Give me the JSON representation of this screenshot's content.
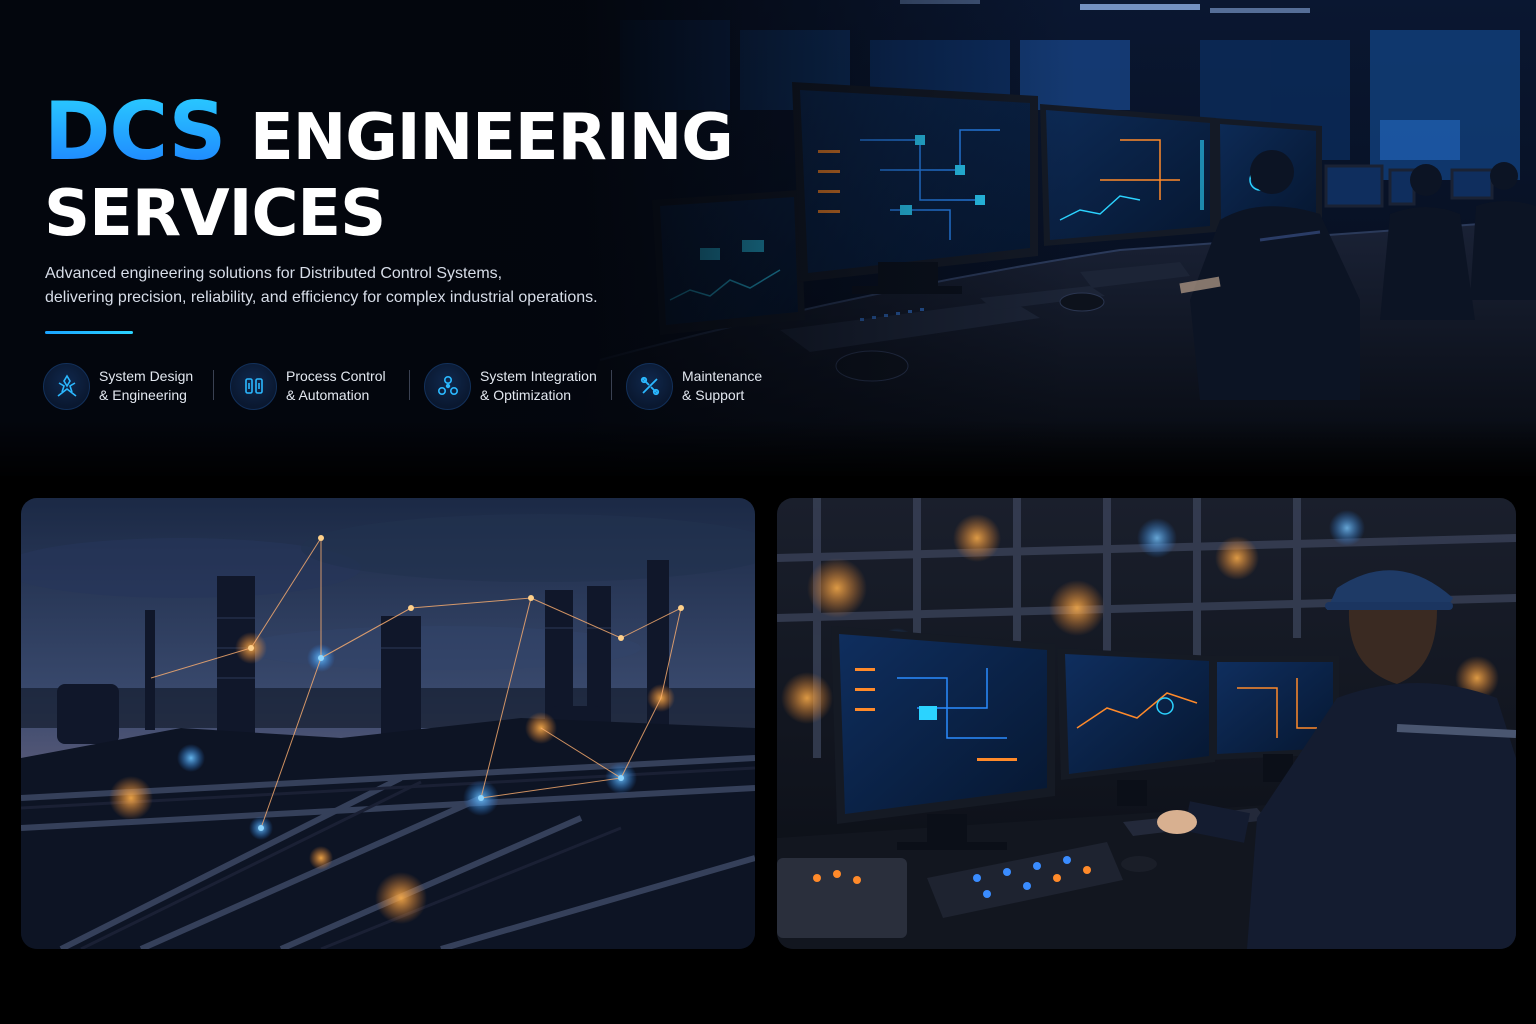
{
  "hero": {
    "title_accent": "DCS",
    "title_rest": "ENGINEERING",
    "title_line2": "SERVICES",
    "subtitle_line1": "Advanced engineering solutions for Distributed Control Systems,",
    "subtitle_line2": "delivering precision, reliability, and efficiency for complex industrial operations."
  },
  "features": [
    {
      "icon": "system-design-icon",
      "line1": "System Design",
      "line2": "& Engineering"
    },
    {
      "icon": "process-control-icon",
      "line1": "Process Control",
      "line2": "& Automation"
    },
    {
      "icon": "system-integration-icon",
      "line1": "System Integration",
      "line2": "& Optimization"
    },
    {
      "icon": "maintenance-wrench-icon",
      "line1": "Maintenance",
      "line2": "& Support"
    }
  ],
  "colors": {
    "accent_cyan": "#2bd3ff",
    "accent_blue": "#1d7cff",
    "background": "#000000",
    "hero_background": "#050a16",
    "panel_glow_orange": "#ff9a3a"
  }
}
